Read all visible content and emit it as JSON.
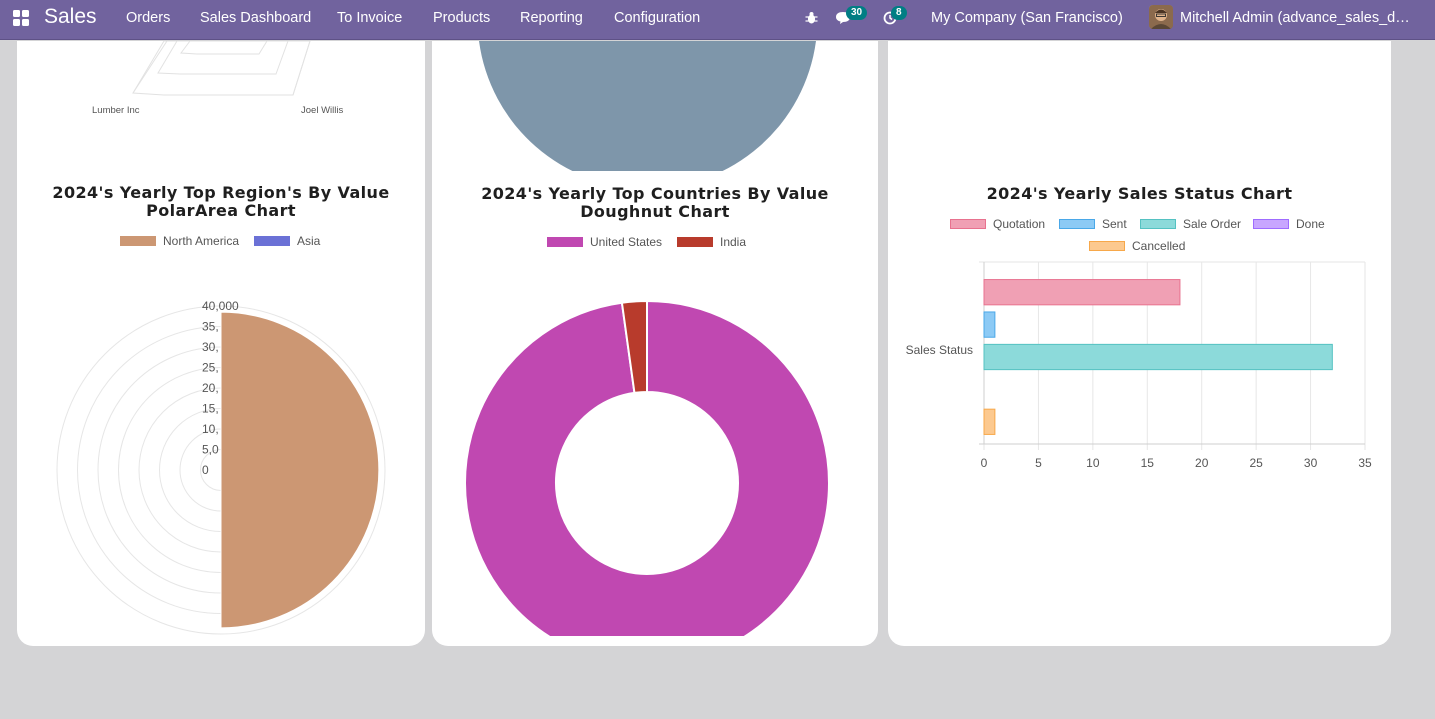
{
  "navbar": {
    "brand": "Sales",
    "menu": [
      "Orders",
      "Sales Dashboard",
      "To Invoice",
      "Products",
      "Reporting",
      "Configuration"
    ],
    "messages_count": "30",
    "activities_count": "8",
    "company": "My Company (San Francisco)",
    "user": "Mitchell Admin (advance_sales_dashboard)"
  },
  "colors": {
    "navbar": "#71639e",
    "north_america": "#cc9773",
    "asia": "#6b71d6",
    "united_states": "#c048b1",
    "india": "#b83b2c",
    "pie_slice": "#7e96aa"
  },
  "radar_partial": {
    "labels": [
      "Lumber Inc",
      "Joel Willis"
    ]
  },
  "chart_data": [
    {
      "type": "polarArea",
      "title": "2024's Yearly Top Region's By Value PolarArea Chart",
      "categories": [
        "North America",
        "Asia"
      ],
      "values": [
        38500,
        0
      ],
      "r_ticks": [
        "40,000",
        "35,",
        "30,",
        "25,",
        "20,",
        "15,",
        "10,",
        "5,0",
        "0"
      ],
      "rlim": [
        0,
        40000
      ]
    },
    {
      "type": "doughnut",
      "title": "2024's Yearly Top Countries By Value Doughnut Chart",
      "categories": [
        "United States",
        "India"
      ],
      "values": [
        97.8,
        2.2
      ]
    },
    {
      "type": "bar",
      "orientation": "horizontal",
      "title": "2024's Yearly Sales Status Chart",
      "y_category": "Sales Status",
      "series": [
        {
          "name": "Quotation",
          "value": 18,
          "fill": "#f0a0b4",
          "stroke": "#e8728f"
        },
        {
          "name": "Sent",
          "value": 1,
          "fill": "#8ccaf5",
          "stroke": "#4aa8e8"
        },
        {
          "name": "Sale Order",
          "value": 32,
          "fill": "#8cdada",
          "stroke": "#55c2c2"
        },
        {
          "name": "Done",
          "value": 0,
          "fill": "#c8a6ff",
          "stroke": "#9f6cff"
        },
        {
          "name": "Cancelled",
          "value": 1,
          "fill": "#fcc98f",
          "stroke": "#f7a84a"
        }
      ],
      "x_ticks": [
        "0",
        "5",
        "10",
        "15",
        "20",
        "25",
        "30",
        "35"
      ],
      "xlim": [
        0,
        35
      ],
      "grid": true,
      "legend": "top"
    }
  ]
}
